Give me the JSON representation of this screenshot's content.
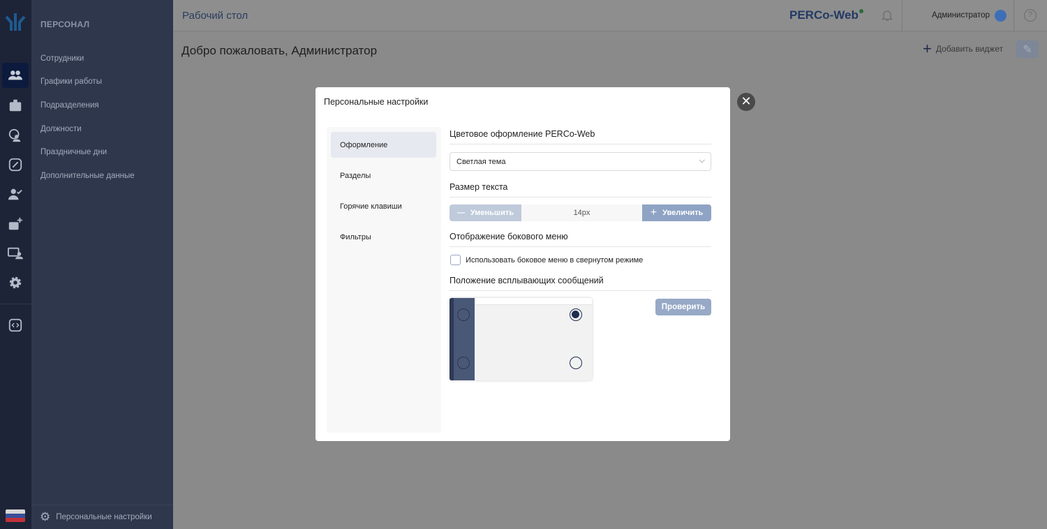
{
  "header": {
    "title": "Рабочий стол",
    "brand": "PERCo-Web",
    "user": "Администратор",
    "help": "?"
  },
  "main": {
    "welcome": "Добро пожаловать, Администратор",
    "add_widget": "Добавить виджет"
  },
  "panel": {
    "title": "ПЕРСОНАЛ",
    "items": [
      "Сотрудники",
      "Графики работы",
      "Подразделения",
      "Должности",
      "Праздничные дни",
      "Дополнительные данные"
    ],
    "footer": "Персональные настройки"
  },
  "modal": {
    "title": "Персональные настройки",
    "nav": [
      "Оформление",
      "Разделы",
      "Горячие клавиши",
      "Фильтры"
    ],
    "color_section": "Цветовое оформление PERCo-Web",
    "theme": "Светлая тема",
    "text_size_section": "Размер текста",
    "decrease": "Уменьшить",
    "size": "14px",
    "increase": "Увеличить",
    "side_menu_section": "Отображение бокового меню",
    "collapsed_label": "Использовать боковое меню в свернутом режиме",
    "collapsed": false,
    "popup_section": "Положение всплывающих сообщений",
    "popup_position": "top-right",
    "check": "Проверить"
  }
}
